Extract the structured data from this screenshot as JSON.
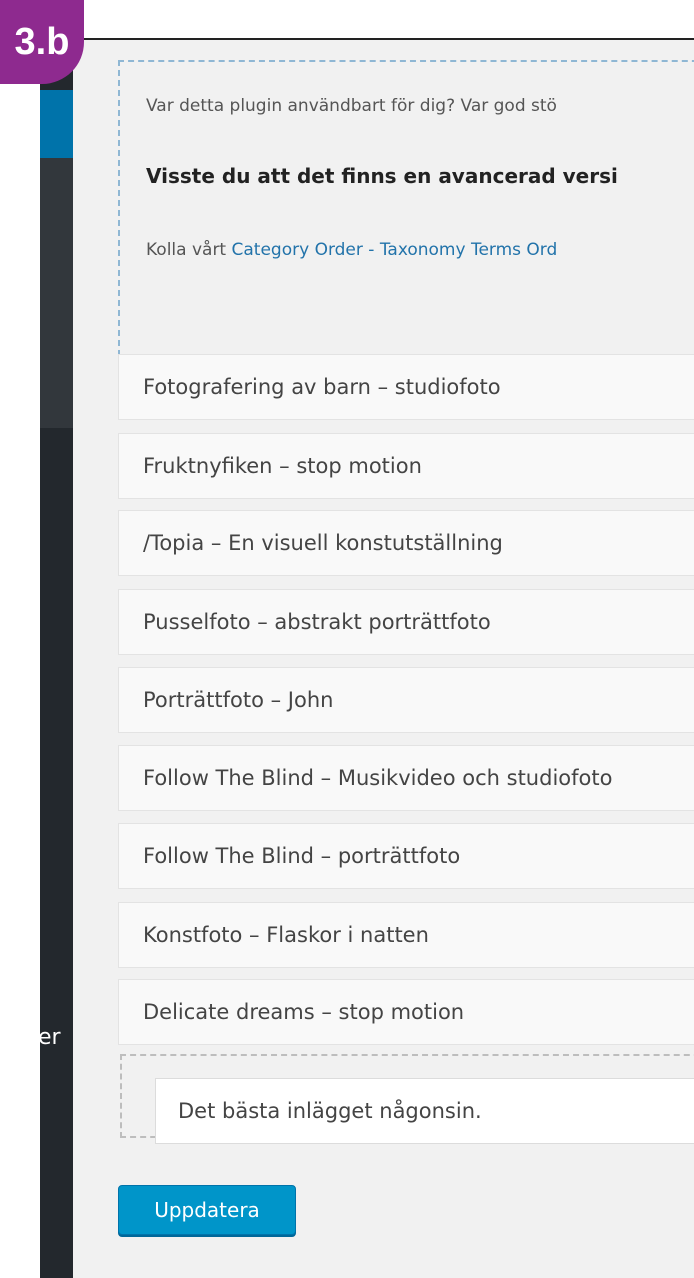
{
  "badge": {
    "label": "3.b"
  },
  "sidebar": {
    "fragment_label": "er"
  },
  "notice": {
    "line1": "Var detta plugin användbart för dig? Var god stö",
    "line2": "Visste du att det finns en avancerad versi",
    "line3_prefix": "Kolla vårt ",
    "line3_link": "Category Order - Taxonomy Terms Ord"
  },
  "items": [
    "Fotografering av barn – studiofoto",
    "Fruktnyfiken – stop motion",
    "/Topia – En visuell konstutställning",
    "Pusselfoto – abstrakt porträttfoto",
    "Porträttfoto – John",
    "Follow The Blind – Musikvideo och studiofoto",
    "Follow The Blind – porträttfoto",
    "Konstfoto – Flaskor i natten",
    "Delicate dreams – stop motion"
  ],
  "dragged_item": "Det bästa inlägget någonsin.",
  "update_button": "Uppdatera"
}
